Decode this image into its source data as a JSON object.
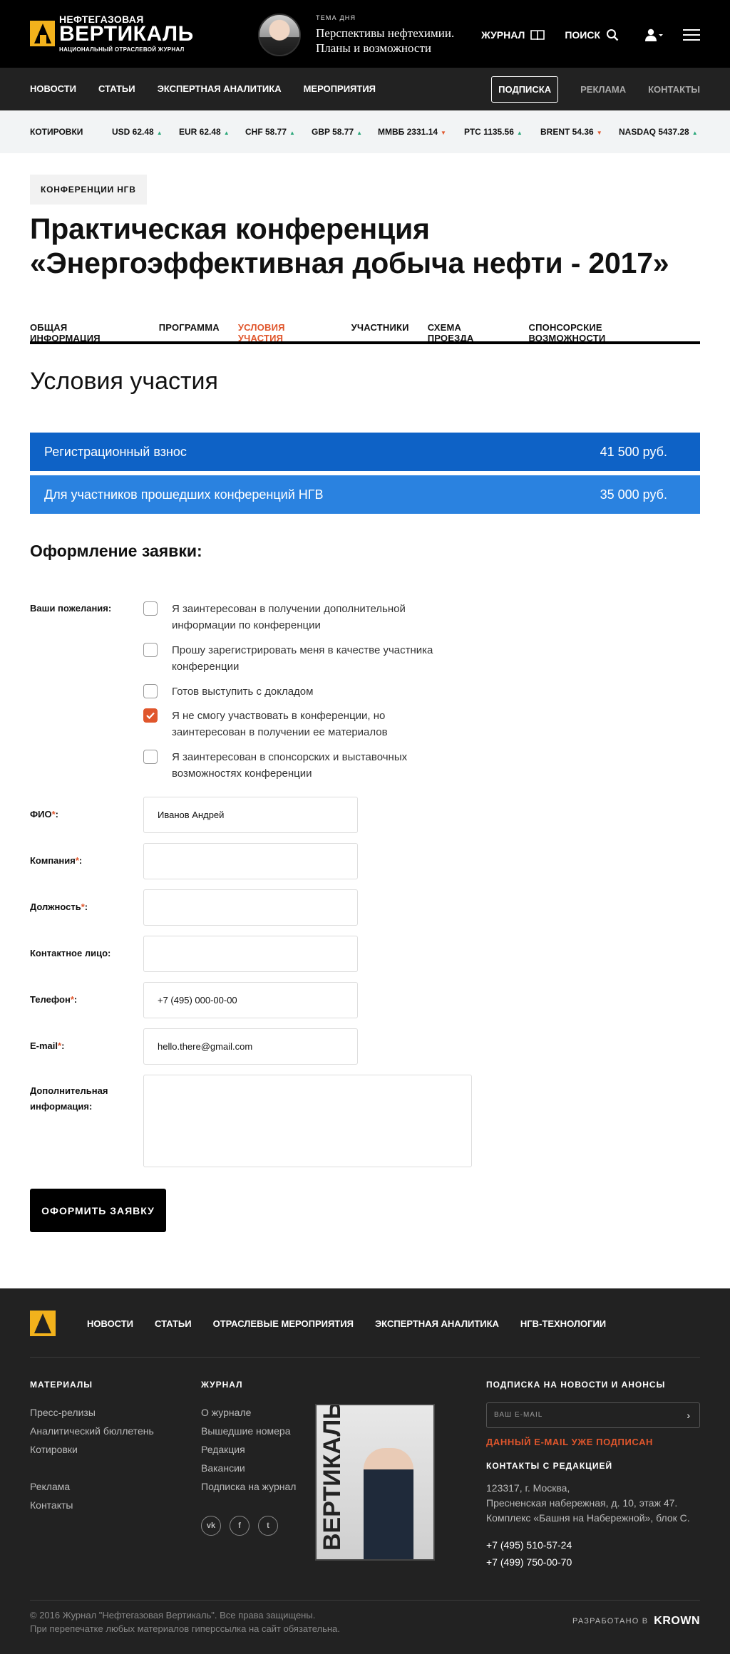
{
  "header": {
    "logo_line1": "НЕФТЕГАЗОВАЯ",
    "logo_line2": "ВЕРТИКАЛЬ",
    "logo_line3": "НАЦИОНАЛЬНЫЙ ОТРАСЛЕВОЙ ЖУРНАЛ",
    "topic_label": "ТЕМА ДНЯ",
    "topic_title_1": "Перспективы нефтехимии.",
    "topic_title_2": "Планы и возможности",
    "journal": "ЖУРНАЛ",
    "search": "ПОИСК"
  },
  "nav": {
    "items": [
      "НОВОСТИ",
      "СТАТЬИ",
      "ЭКСПЕРТНАЯ АНАЛИТИКА",
      "МЕРОПРИЯТИЯ"
    ],
    "subscribe": "ПОДПИСКА",
    "ads": "РЕКЛАМА",
    "contacts": "КОНТАКТЫ"
  },
  "ticker": {
    "label": "КОТИРОВКИ",
    "items": [
      {
        "text": "USD 62.48",
        "dir": "up"
      },
      {
        "text": "EUR 62.48",
        "dir": "up"
      },
      {
        "text": "CHF 58.77",
        "dir": "up"
      },
      {
        "text": "GBP 58.77",
        "dir": "up"
      },
      {
        "text": "ММВБ 2331.14",
        "dir": "down"
      },
      {
        "text": "РТС 1135.56",
        "dir": "up"
      },
      {
        "text": "BRENT 54.36",
        "dir": "down"
      },
      {
        "text": "NASDAQ 5437.28",
        "dir": "up"
      }
    ]
  },
  "page": {
    "badge": "КОНФЕРЕНЦИИ НГВ",
    "title_1": "Практическая конференция",
    "title_2": "«Энергоэффективная добыча нефти - 2017»",
    "tabs": [
      "ОБЩАЯ ИНФОРМАЦИЯ",
      "ПРОГРАММА",
      "УСЛОВИЯ УЧАСТИЯ",
      "УЧАСТНИКИ",
      "СХЕМА ПРОЕЗДА",
      "СПОНСОРСКИЕ ВОЗМОЖНОСТИ"
    ],
    "active_tab": 2,
    "section_title": "Условия участия",
    "fees": [
      {
        "label": "Регистрационный взнос",
        "value": "41 500 руб."
      },
      {
        "label": "Для участников прошедших конференций НГВ",
        "value": "35 000 руб."
      }
    ],
    "form_title": "Оформление заявки:"
  },
  "form": {
    "wishes_label": "Ваши пожелания:",
    "checkboxes": [
      {
        "line1": "Я заинтересован в получении дополнительной",
        "line2": "информации по конференции",
        "checked": false
      },
      {
        "line1": "Прошу зарегистрировать меня в качестве участника",
        "line2": "конференции",
        "checked": false
      },
      {
        "line1": "Готов выступить с докладом",
        "line2": "",
        "checked": false
      },
      {
        "line1": "Я не смогу участвовать в конференции, но",
        "line2": "заинтересован в получении ее материалов",
        "checked": true
      },
      {
        "line1": "Я заинтересован в спонсорских и выставочных",
        "line2": "возможностях конференции",
        "checked": false
      }
    ],
    "fields": [
      {
        "label": "ФИО",
        "required": true,
        "value": "Иванов Андрей"
      },
      {
        "label": "Компания",
        "required": true,
        "value": ""
      },
      {
        "label": "Должность",
        "required": true,
        "value": ""
      },
      {
        "label": "Контактное лицо:",
        "required": false,
        "value": ""
      },
      {
        "label": "Телефон",
        "required": true,
        "value": "+7 (495) 000-00-00"
      },
      {
        "label": "E-mail",
        "required": true,
        "value": "hello.there@gmail.com"
      }
    ],
    "extra_label_1": "Дополнительная",
    "extra_label_2": "информация:",
    "submit": "ОФОРМИТЬ ЗАЯВКУ"
  },
  "footer": {
    "nav": [
      "НОВОСТИ",
      "СТАТЬИ",
      "ОТРАСЛЕВЫЕ МЕРОПРИЯТИЯ",
      "ЭКСПЕРТНАЯ АНАЛИТИКА",
      "НГВ-ТЕХНОЛОГИИ"
    ],
    "materials_title": "МАТЕРИАЛЫ",
    "materials": [
      "Пресс-релизы",
      "Аналитический бюллетень",
      "Котировки",
      "Реклама",
      "Контакты"
    ],
    "journal_title": "ЖУРНАЛ",
    "journal": [
      "О журнале",
      "Вышедшие номера",
      "Редакция",
      "Вакансии",
      "Подписка на журнал"
    ],
    "cover_word": "ВЕРТИКАЛЬ",
    "social": [
      "vk",
      "f",
      "t"
    ],
    "subscribe_title": "ПОДПИСКА НА НОВОСТИ И АНОНСЫ",
    "email_placeholder": "ВАШ E-MAIL",
    "subscribed_msg": "ДАННЫЙ E-MAIL УЖЕ ПОДПИСАН",
    "contacts_title": "КОНТАКТЫ С РЕДАКЦИЕЙ",
    "address_1": "123317, г. Москва,",
    "address_2": "Пресненская набережная, д. 10, этаж 47.",
    "address_3": "Комплекс «Башня на Набережной», блок С.",
    "phone_1": "+7 (495) 510-57-24",
    "phone_2": "+7 (499) 750-00-70",
    "copy_1": "© 2016 Журнал \"Нефтегазовая Вертикаль\". Все права защищены.",
    "copy_2": "При перепечатке любых материалов гиперссылка на сайт обязательна.",
    "dev_label": "РАЗРАБОТАНО В",
    "dev_name": "KROWN"
  },
  "colors": {
    "accent": "#e0562c",
    "brand_yellow": "#f2b21c",
    "fee_dark": "#0e62c6",
    "fee_light": "#2a82e0"
  }
}
